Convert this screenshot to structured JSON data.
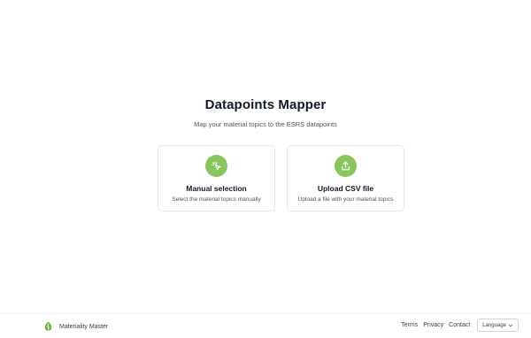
{
  "header": {
    "title": "Datapoints Mapper",
    "subtitle": "Map your material topics to the ESRS datapoints"
  },
  "cards": [
    {
      "title": "Manual selection",
      "description": "Select the material topics manually",
      "icon": "pointer-click-icon"
    },
    {
      "title": "Upload CSV file",
      "description": "Upload a file with your material topics",
      "icon": "upload-icon"
    }
  ],
  "colors": {
    "accent": "#86c65b",
    "text_primary": "#111827",
    "text_secondary": "#4b5563",
    "border": "#e5e7eb"
  },
  "footer": {
    "brand_name": "Materiality Master",
    "brand_icon": "leaf-icon",
    "links": [
      "Terms",
      "Privacy",
      "Contact"
    ],
    "language_label": "Language"
  }
}
